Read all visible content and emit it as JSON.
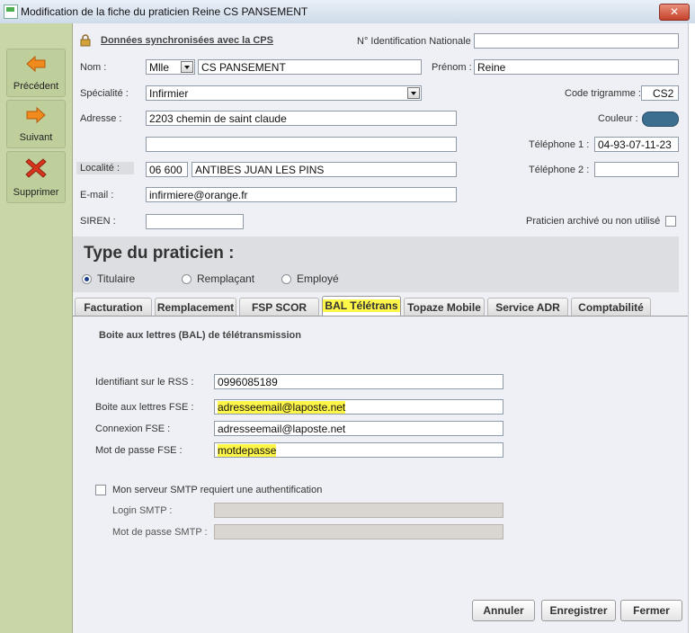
{
  "window": {
    "title": "Modification de la fiche du praticien Reine CS PANSEMENT",
    "close": "✕"
  },
  "sidebar": {
    "prev": "Précédent",
    "next": "Suivant",
    "delete": "Supprimer"
  },
  "sync": {
    "label": "Données synchronisées avec la CPS"
  },
  "fields": {
    "nin_label": "N° Identification Nationale :",
    "nin_value": "",
    "nom_label": "Nom :",
    "civilite": "Mlle",
    "nom_value": "CS PANSEMENT",
    "prenom_label": "Prénom :",
    "prenom_value": "Reine",
    "specialite_label": "Spécialité :",
    "specialite_value": "Infirmier",
    "trigramme_label": "Code trigramme :",
    "trigramme_value": "CS2",
    "adresse_label": "Adresse :",
    "adresse_value": "2203 chemin de saint claude",
    "adresse2_value": "",
    "couleur_label": "Couleur :",
    "tel1_label": "Téléphone 1 :",
    "tel1_value": "04-93-07-11-23",
    "tel2_label": "Téléphone 2 :",
    "tel2_value": "",
    "localite_label": "Localité :",
    "cp_value": "06 600",
    "ville_value": "ANTIBES JUAN LES PINS",
    "email_label": "E-mail :",
    "email_value": "infirmiere@orange.fr",
    "siren_label": "SIREN :",
    "siren_value": "",
    "archive_label": "Praticien archivé ou non utilisé"
  },
  "type": {
    "title": "Type du praticien :",
    "options": [
      "Titulaire",
      "Remplaçant",
      "Employé"
    ],
    "selected": "Titulaire"
  },
  "tabs": [
    "Facturation",
    "Remplacement",
    "FSP SCOR",
    "BAL Télétrans",
    "Topaze Mobile",
    "Service ADR",
    "Comptabilité"
  ],
  "bal": {
    "section_title": "Boite aux lettres (BAL) de télétransmission",
    "rss_label": "Identifiant sur le RSS :",
    "rss_value": "0996085189",
    "fse_label": "Boite aux lettres FSE :",
    "fse_value": "adresseemail@laposte.net",
    "conn_label": "Connexion FSE :",
    "conn_value": "adresseemail@laposte.net",
    "pwd_label": "Mot de passe FSE :",
    "pwd_value": "motdepasse",
    "smtp_check_label": "Mon  serveur SMTP requiert une authentification",
    "smtp_login_label": "Login SMTP :",
    "smtp_pwd_label": "Mot de passe SMTP :"
  },
  "buttons": {
    "cancel": "Annuler",
    "save": "Enregistrer",
    "close": "Fermer"
  },
  "colors": {
    "couleur_swatch": "#3c6e8f",
    "highlight": "#fff64a"
  }
}
